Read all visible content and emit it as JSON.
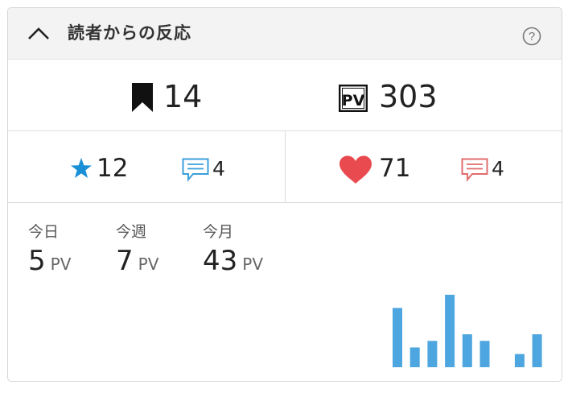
{
  "header": {
    "title": "読者からの反応",
    "collapse_icon": "chevron-up-icon",
    "help_icon": "question-circle-icon"
  },
  "summary": {
    "bookmarks": {
      "icon": "bookmark-icon",
      "count": "14"
    },
    "pageviews": {
      "icon": "pv-icon",
      "icon_label": "PV",
      "count": "303"
    }
  },
  "reactions": {
    "star": {
      "icon": "star-icon",
      "count": "12",
      "color": "#1a8fd6"
    },
    "star_comments": {
      "icon": "comment-icon",
      "count": "4",
      "color": "#3b9fdb"
    },
    "heart": {
      "icon": "heart-icon",
      "count": "71",
      "color": "#e84a4f"
    },
    "heart_comments": {
      "icon": "comment-icon",
      "count": "4",
      "color": "#e06c6c"
    }
  },
  "stats": [
    {
      "label": "今日",
      "value": "5",
      "unit": "PV"
    },
    {
      "label": "今週",
      "value": "7",
      "unit": "PV"
    },
    {
      "label": "今月",
      "value": "43",
      "unit": "PV"
    }
  ],
  "chart_data": {
    "type": "bar",
    "values": [
      9,
      3,
      4,
      11,
      5,
      4,
      0,
      2,
      5
    ],
    "ylim": [
      0,
      11
    ],
    "color": "#4da6e0",
    "grid": false
  }
}
